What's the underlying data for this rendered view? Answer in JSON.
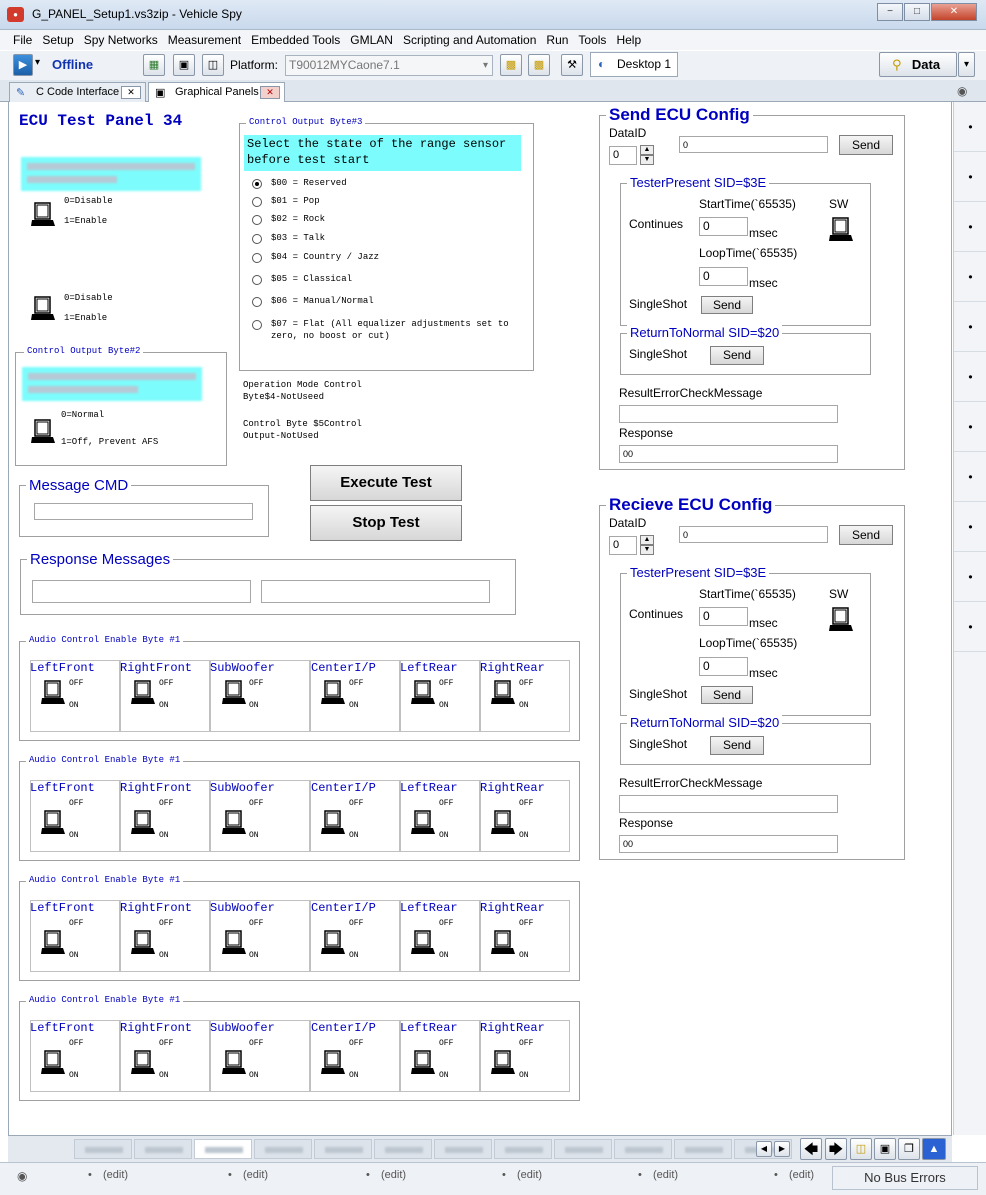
{
  "window": {
    "title": "G_PANEL_Setup1.vs3zip - Vehicle Spy",
    "app_icon": "vehicle-spy-logo",
    "min": "−",
    "max": "□",
    "close": "✕"
  },
  "menu": [
    "File",
    "Setup",
    "Spy Networks",
    "Measurement",
    "Embedded Tools",
    "GMLAN",
    "Scripting and Automation",
    "Run",
    "Tools",
    "Help"
  ],
  "toolbar": {
    "status": "Offline",
    "platform_label": "Platform:",
    "platform_value": "T90012MYCaone7.1",
    "desktop_tab": "Desktop 1",
    "data_button": "Data",
    "dropdown_arrow": "▾"
  },
  "doc_tabs": [
    {
      "label": "C Code Interface"
    },
    {
      "label": "Graphical Panels"
    }
  ],
  "panel": {
    "title": "ECU Test Panel 34",
    "switch1": {
      "off": "0=Disable",
      "on": "1=Enable"
    },
    "switch2": {
      "off": "0=Disable",
      "on": "1=Enable"
    },
    "cob2": {
      "title": "Control Output Byte#2",
      "off": "0=Normal",
      "on": "1=Off, Prevent AFS"
    },
    "cob3": {
      "title": "Control Output Byte#3",
      "prompt": "Select the state of the range sensor before test start",
      "options": [
        "$00 = Reserved",
        "$01 = Pop",
        "$02 = Rock",
        "$03 = Talk",
        "$04 = Country / Jazz",
        "$05 = Classical",
        "$06 = Manual/Normal",
        "$07 = Flat (All equalizer adjustments set to zero, no boost or cut)"
      ]
    },
    "op_mode": "Operation Mode Control Byte$4-NotUseed",
    "cb5": "Control Byte $5Control Output-NotUsed",
    "message_cmd": "Message CMD",
    "response_messages": "Response Messages",
    "execute_test": "Execute Test",
    "stop_test": "Stop Test",
    "audio": {
      "title": "Audio Control Enable Byte #1",
      "channels": [
        "LeftFront",
        "RightFront",
        "SubWoofer",
        "CenterI/P",
        "LeftRear",
        "RightRear"
      ],
      "off": "OFF",
      "on": "ON"
    }
  },
  "ecu": [
    {
      "title": "Send ECU Config",
      "dataid": "DataID",
      "dataid_value": "0",
      "data_value": "0",
      "send": "Send",
      "tp_title": "TesterPresent SID=$3E",
      "continues": "Continues",
      "start": "StartTime(`65535)",
      "start_value": "0",
      "loop": "LoopTime(`65535)",
      "loop_value": "0",
      "msec": "msec",
      "sw": "SW",
      "singleshot": "SingleShot",
      "rtn_title": "ReturnToNormal SID=$20",
      "result": "ResultErrorCheckMessage",
      "response": "Response",
      "response_value": "00"
    },
    {
      "title": "Recieve ECU Config",
      "dataid": "DataID",
      "dataid_value": "0",
      "data_value": "0",
      "send": "Send",
      "tp_title": "TesterPresent SID=$3E",
      "continues": "Continues",
      "start": "StartTime(`65535)",
      "start_value": "0",
      "loop": "LoopTime(`65535)",
      "loop_value": "0",
      "msec": "msec",
      "sw": "SW",
      "singleshot": "SingleShot",
      "rtn_title": "ReturnToNormal SID=$20",
      "result": "ResultErrorCheckMessage",
      "response": "Response",
      "response_value": "00"
    }
  ],
  "status": {
    "edit": "(edit)",
    "bullet": "•",
    "bus": "No Bus Errors"
  },
  "strip_bullet": "•"
}
